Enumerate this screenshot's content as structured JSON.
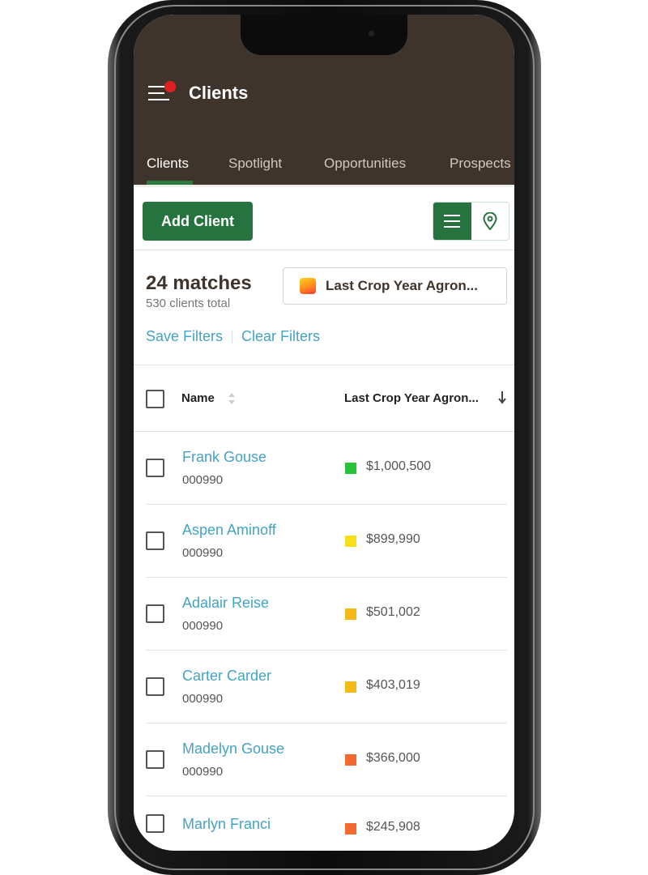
{
  "header": {
    "title": "Clients",
    "notification": true
  },
  "tabs": [
    {
      "label": "Clients",
      "active": true
    },
    {
      "label": "Spotlight"
    },
    {
      "label": "Opportunities"
    },
    {
      "label": "Prospects"
    }
  ],
  "toolbar": {
    "add_label": "Add Client",
    "view_list_icon": "list-icon",
    "view_map_icon": "map-pin-icon",
    "active_view": "list"
  },
  "summary": {
    "matches": "24 matches",
    "total": "530 clients total"
  },
  "filter": {
    "label": "Last Crop Year Agron..."
  },
  "links": {
    "save": "Save Filters",
    "clear": "Clear Filters"
  },
  "table": {
    "col_name": "Name",
    "col_value": "Last Crop Year Agron...",
    "rows": [
      {
        "name": "Frank Gouse",
        "code": "000990",
        "value": "$1,000,500",
        "color": "#27c23a"
      },
      {
        "name": "Aspen Aminoff",
        "code": "000990",
        "value": "$899,990",
        "color": "#f5e11a"
      },
      {
        "name": "Adalair Reise",
        "code": "000990",
        "value": "$501,002",
        "color": "#f5b91a"
      },
      {
        "name": "Carter Carder",
        "code": "000990",
        "value": "$403,019",
        "color": "#f5b91a"
      },
      {
        "name": "Madelyn Gouse",
        "code": "000990",
        "value": "$366,000",
        "color": "#f26a30"
      },
      {
        "name": "Marlyn Franci",
        "code": "",
        "value": "$245,908",
        "color": "#f26a30"
      }
    ]
  }
}
